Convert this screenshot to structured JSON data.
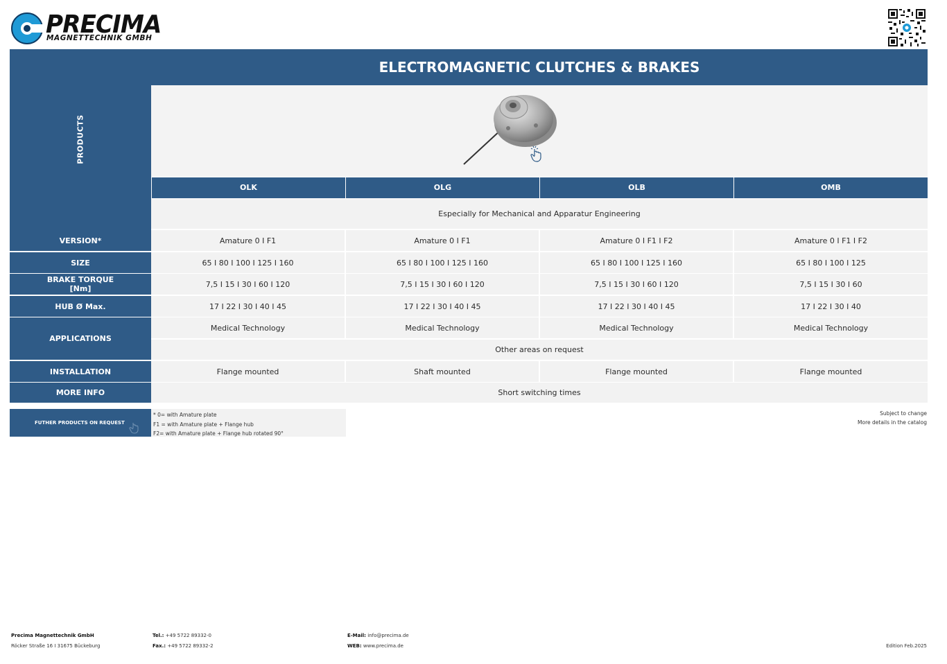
{
  "brand": {
    "name": "PRECIMA",
    "subtitle": "MAGNETTECHNIK GMBH"
  },
  "title": "ELECTROMAGNETIC CLUTCHES & BRAKES",
  "sidebar_label": "PRODUCTS",
  "columns": [
    "OLK",
    "OLG",
    "OLB",
    "OMB"
  ],
  "intro_row": "Especially for Mechanical and Apparatur Engineering",
  "rows": {
    "version": {
      "label": "VERSION*",
      "values": [
        "Amature 0  I  F1",
        "Amature 0  I  F1",
        "Amature 0  I  F1  I  F2",
        "Amature 0  I  F1  I  F2"
      ]
    },
    "size": {
      "label": "SIZE",
      "values": [
        "65  I  80  I  100  I  125  I  160",
        "65  I  80  I  100  I  125  I  160",
        "65  I  80  I  100  I  125  I  160",
        "65  I  80  I  100  I  125"
      ]
    },
    "brake_torque": {
      "label": "BRAKE TORQUE",
      "label2": "[Nm]",
      "values": [
        "7,5  I  15  I  30  I  60  I  120",
        "7,5  I  15  I  30  I  60  I  120",
        "7,5  I  15  I  30  I  60  I  120",
        "7,5  I  15  I  30  I  60"
      ]
    },
    "hub": {
      "label": "HUB Ø Max.",
      "values": [
        "17  I  22  I  30  I  40  I  45",
        "17  I  22  I  30  I  40  I  45",
        "17  I  22  I  30  I  40  I  45",
        "17  I  22  I  30  I  40"
      ]
    },
    "applications": {
      "label": "APPLICATIONS",
      "values": [
        "Medical Technology",
        "Medical Technology",
        "Medical Technology",
        "Medical Technology"
      ],
      "extra": "Other areas on request"
    },
    "installation": {
      "label": "INSTALLATION",
      "values": [
        "Flange mounted",
        "Shaft mounted",
        "Flange mounted",
        "Flange mounted"
      ]
    },
    "more_info": {
      "label": "MORE INFO",
      "value": "Short switching times"
    }
  },
  "further_products": "FUTHER PRODUCTS ON REQUEST",
  "footnotes": [
    "* 0= with Amature plate",
    "F1 = with Amature plate + Flange hub",
    "F2=  with Amature plate + Flange hub rotated 90°"
  ],
  "right_notes": [
    "Subject to change",
    "More details in the catalog"
  ],
  "footer": {
    "company": "Precima Magnettechnik GmbH",
    "address": "Röcker Straße 16  I  31675 Bückeburg",
    "tel_label": "Tel.:",
    "tel": "+49 5722 89332-0",
    "fax_label": "Fax.:",
    "fax": "+49 5722 89332-2",
    "email_label": "E-Mail:",
    "email": "info@precima.de",
    "web_label": "WEB:",
    "web": "www.precima.de",
    "edition": "Edition Feb.2025"
  },
  "colors": {
    "header_blue": "#2f5b87",
    "cell_grey": "#f2f2f2",
    "logo_blue": "#1f9ad6"
  }
}
